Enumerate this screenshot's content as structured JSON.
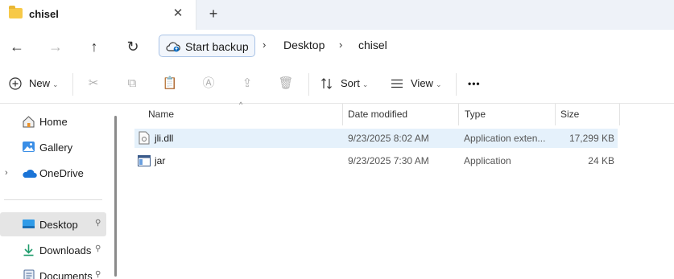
{
  "tab": {
    "title": "chisel",
    "close_glyph": "✕",
    "new_tab_glyph": "+"
  },
  "nav": {
    "back_glyph": "←",
    "forward_glyph": "→",
    "up_glyph": "↑",
    "refresh_glyph": "↻"
  },
  "address": {
    "backup_label": "Start backup",
    "crumbs": [
      "Desktop",
      "chisel"
    ],
    "separator": "›"
  },
  "toolbar": {
    "new_label": "New",
    "sort_label": "Sort",
    "view_label": "View",
    "more_glyph": "•••",
    "chevron": "⌄"
  },
  "sidebar": {
    "items": [
      {
        "label": "Home",
        "icon": "home-icon"
      },
      {
        "label": "Gallery",
        "icon": "gallery-icon"
      },
      {
        "label": "OneDrive",
        "icon": "cloud-icon"
      },
      {
        "label": "Desktop",
        "icon": "desktop-icon"
      },
      {
        "label": "Downloads",
        "icon": "download-icon"
      },
      {
        "label": "Documents",
        "icon": "documents-icon"
      }
    ],
    "pin_glyph": "📌",
    "expander_glyph": "›"
  },
  "columns": {
    "name": "Name",
    "date": "Date modified",
    "type": "Type",
    "size": "Size",
    "sort_glyph": "^"
  },
  "files": [
    {
      "name": "jli.dll",
      "date": "9/23/2025 8:02 AM",
      "type": "Application exten...",
      "size": "17,299 KB",
      "icon": "dll-file-icon"
    },
    {
      "name": "jar",
      "date": "9/23/2025 7:30 AM",
      "type": "Application",
      "size": "24 KB",
      "icon": "exe-file-icon"
    }
  ],
  "colors": {
    "accent": "#0067c0",
    "selection": "#e5f1fb",
    "titlebar": "#eef2f8"
  }
}
